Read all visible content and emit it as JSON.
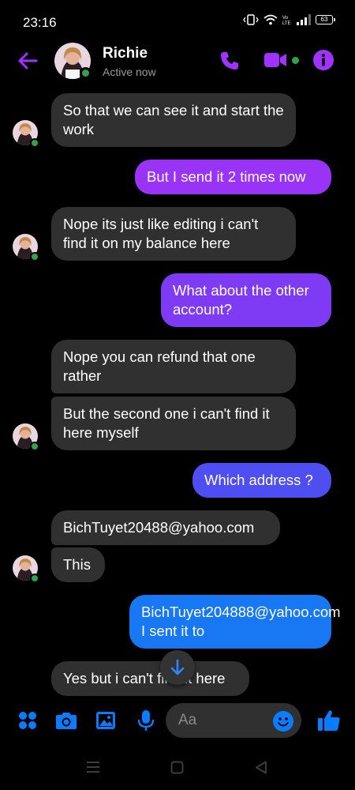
{
  "status_bar": {
    "time": "23:16",
    "battery": "63"
  },
  "header": {
    "contact_name": "Richie",
    "contact_status": "Active now"
  },
  "messages": [
    {
      "direction": "in",
      "text": "So that we can see it and start the work"
    },
    {
      "direction": "out",
      "text": "But I send it 2 times now"
    },
    {
      "direction": "in",
      "text": "Nope its just like editing i can't find it on my balance here"
    },
    {
      "direction": "out",
      "text": "What about the other account?"
    },
    {
      "direction": "in",
      "text": "Nope you can refund that one rather"
    },
    {
      "direction": "in",
      "text": "But the second one i can't find it here myself"
    },
    {
      "direction": "out",
      "text": "Which address ?"
    },
    {
      "direction": "in",
      "text": "BichTuyet20488@yahoo.com"
    },
    {
      "direction": "in",
      "text": "This"
    },
    {
      "direction": "out",
      "text": "BichTuyet204888@yahoo.com I sent it to"
    },
    {
      "direction": "in",
      "text": "Yes but i can't find it here"
    }
  ],
  "composer": {
    "placeholder": "Aa"
  },
  "colors": {
    "accent": "#a033ff",
    "incoming_bubble": "#303030",
    "online": "#31a24c"
  },
  "icons": {
    "back": "arrow-left-icon",
    "call": "phone-icon",
    "video": "video-camera-icon",
    "info": "info-icon",
    "apps": "four-dots-icon",
    "camera": "camera-icon",
    "gallery": "image-icon",
    "mic": "microphone-icon",
    "emoji": "emoji-icon",
    "like": "thumbs-up-icon",
    "scroll": "arrow-down-icon"
  }
}
